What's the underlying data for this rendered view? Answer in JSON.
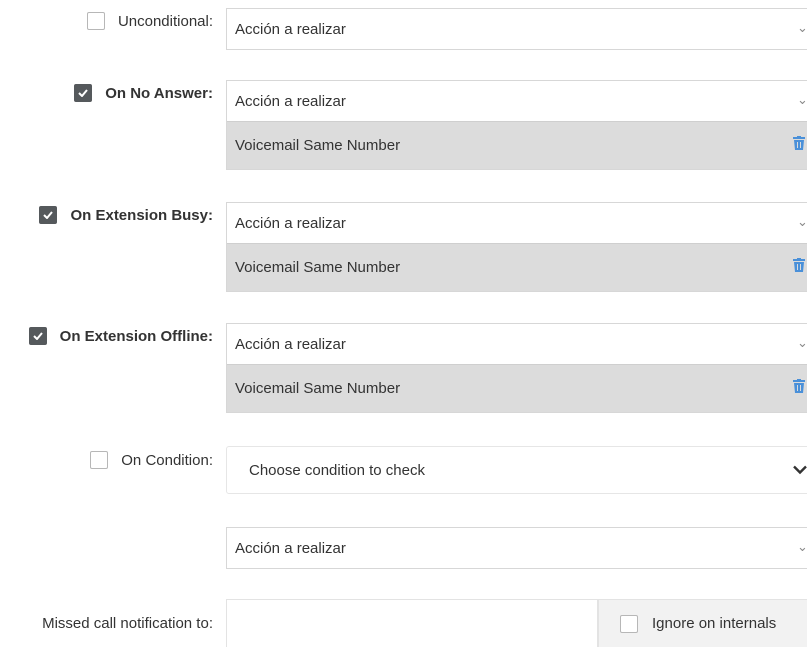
{
  "forwarding": {
    "unconditional": {
      "label": "Unconditional:",
      "checked": false,
      "action_placeholder": "Acción a realizar"
    },
    "no_answer": {
      "label": "On No Answer:",
      "checked": true,
      "action_placeholder": "Acción a realizar",
      "destination": "Voicemail Same Number"
    },
    "busy": {
      "label": "On Extension Busy:",
      "checked": true,
      "action_placeholder": "Acción a realizar",
      "destination": "Voicemail Same Number"
    },
    "offline": {
      "label": "On Extension Offline:",
      "checked": true,
      "action_placeholder": "Acción a realizar",
      "destination": "Voicemail Same Number"
    },
    "condition": {
      "label": "On Condition:",
      "checked": false,
      "select_value": "Choose condition to check",
      "action_placeholder": "Acción a realizar"
    }
  },
  "missed_call": {
    "label": "Missed call notification to:",
    "value": "",
    "ignore_internals_label": "Ignore on internals",
    "ignore_internals_checked": false
  },
  "icons": {
    "checkbox": "checkbox-icon",
    "check": "checkmark-icon",
    "chevron": "chevron-down-icon",
    "trash": "trash-icon"
  },
  "colors": {
    "checkbox_checked": "#55595c",
    "trash": "#4a90d9",
    "assigned_bg": "#dcdcdc"
  }
}
